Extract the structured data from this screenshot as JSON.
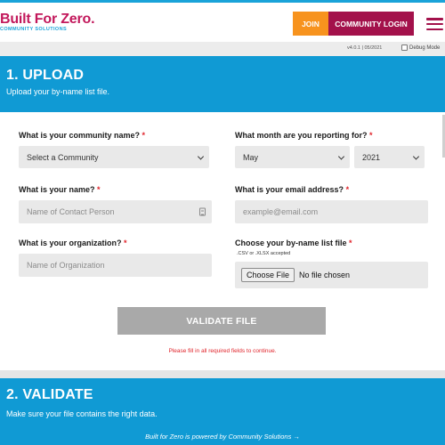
{
  "header": {
    "logo_title": "Built For Zero.",
    "logo_subtitle": "COMMUNITY SOLUTIONS",
    "join_label": "JOIN",
    "login_label": "COMMUNITY LOGIN",
    "menu_icon": "hamburger-icon"
  },
  "version_bar": {
    "version": "v4.0.1 | 05/2021",
    "debug_label": "Debug Mode",
    "debug_checked": false
  },
  "upload_section": {
    "title": "1. UPLOAD",
    "subtitle": "Upload your by-name list file."
  },
  "form": {
    "community": {
      "label": "What is your community name?",
      "required": "*",
      "value": "Select a Community"
    },
    "month": {
      "label": "What month are you reporting for?",
      "required": "*",
      "month_value": "May",
      "year_value": "2021"
    },
    "name": {
      "label": "What is your name?",
      "required": "*",
      "placeholder": "Name of Contact Person"
    },
    "email": {
      "label": "What is your email address?",
      "required": "*",
      "placeholder": "example@email.com"
    },
    "organization": {
      "label": "What is your organization?",
      "required": "*",
      "placeholder": "Name of Organization"
    },
    "file": {
      "label": "Choose your by-name list file",
      "required": "*",
      "hint": ".CSV or .XLSX accepted",
      "button_label": "Choose File",
      "status": "No file chosen"
    },
    "validate_label": "VALIDATE FILE",
    "error_message": "Please fill in all required fields to continue."
  },
  "validate_section": {
    "title": "2. VALIDATE",
    "subtitle": "Make sure your file contains the right data."
  },
  "footer": {
    "text": "Built for Zero is powered by Community Solutions →"
  },
  "colors": {
    "brand_magenta": "#a3114b",
    "brand_orange": "#f7931e",
    "brand_blue": "#109ad4",
    "required_red": "#e0242b"
  }
}
